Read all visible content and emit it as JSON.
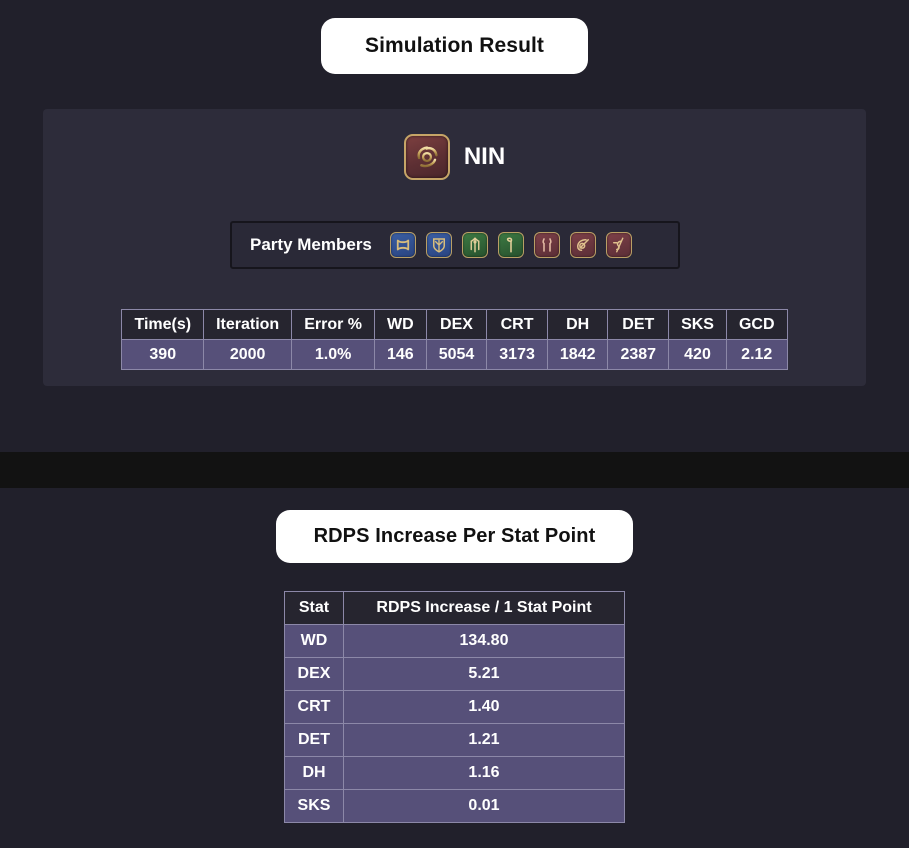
{
  "sections": {
    "simulation": {
      "title": "Simulation Result",
      "job": {
        "abbrev": "NIN",
        "icon": "ninja-job-icon",
        "icon_bg": "#5d2f33",
        "icon_border": "#c6a567"
      },
      "party": {
        "label": "Party Members",
        "members": [
          {
            "icon": "warrior-job-icon",
            "role": "tank",
            "color": "#3b5fa4"
          },
          {
            "icon": "paladin-job-icon",
            "role": "tank",
            "color": "#3b5fa4"
          },
          {
            "icon": "whitemage-job-icon",
            "role": "healer",
            "color": "#3d7a43"
          },
          {
            "icon": "astrologian-job-icon",
            "role": "healer",
            "color": "#3d7a43"
          },
          {
            "icon": "ninja-job-icon",
            "role": "dps",
            "color": "#7e4048"
          },
          {
            "icon": "reaper-job-icon",
            "role": "dps",
            "color": "#7e4048"
          },
          {
            "icon": "bard-job-icon",
            "role": "dps",
            "color": "#7e4048"
          }
        ]
      },
      "stats_table": {
        "headers": [
          "Time(s)",
          "Iteration",
          "Error %",
          "WD",
          "DEX",
          "CRT",
          "DH",
          "DET",
          "SKS",
          "GCD"
        ],
        "values": [
          "390",
          "2000",
          "1.0%",
          "146",
          "5054",
          "3173",
          "1842",
          "2387",
          "420",
          "2.12"
        ]
      }
    },
    "rdps": {
      "title": "RDPS Increase Per Stat Point",
      "table": {
        "headers": [
          "Stat",
          "RDPS Increase / 1 Stat Point"
        ],
        "rows": [
          {
            "stat": "WD",
            "value": "134.80"
          },
          {
            "stat": "DEX",
            "value": "5.21"
          },
          {
            "stat": "CRT",
            "value": "1.40"
          },
          {
            "stat": "DET",
            "value": "1.21"
          },
          {
            "stat": "DH",
            "value": "1.16"
          },
          {
            "stat": "SKS",
            "value": "0.01"
          }
        ]
      }
    }
  },
  "theme": {
    "page_bg": "#21202b",
    "card_bg": "#2d2c3a",
    "band_bg": "#121212",
    "table_header_bg": "#26252f",
    "table_cell_bg": "#565079",
    "table_border": "#8c88a8",
    "pill_bg": "#ffffff",
    "pill_text": "#111111"
  }
}
